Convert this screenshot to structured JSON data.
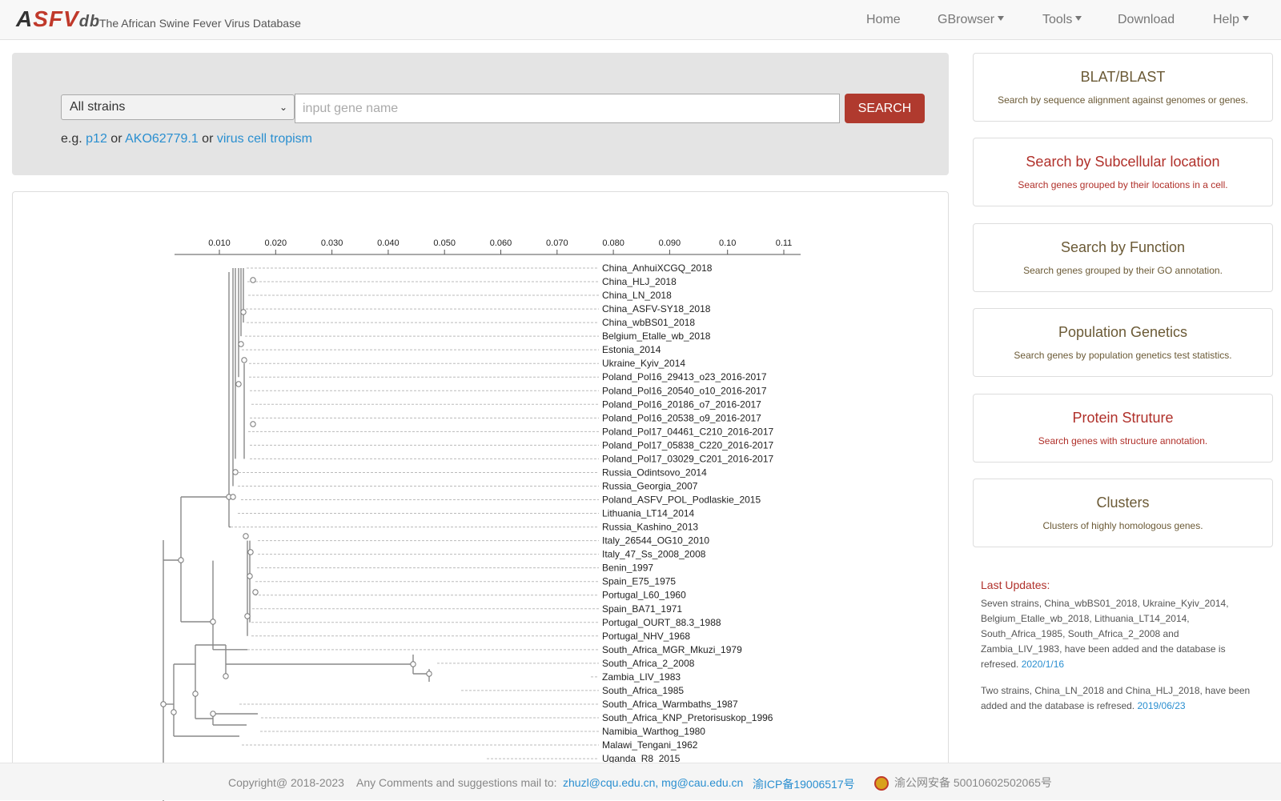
{
  "brand": {
    "logo_a": "A",
    "logo_s": "S",
    "logo_f": "F",
    "logo_v": "V",
    "logo_db": "db",
    "subtitle": "The African Swine Fever Virus Database"
  },
  "nav": {
    "home": "Home",
    "gbrowser": "GBrowser",
    "tools": "Tools",
    "download": "Download",
    "help": "Help"
  },
  "search": {
    "selected_strain": "All strains",
    "placeholder": "input gene name",
    "button": "SEARCH",
    "eg": "e.g.",
    "or": "or",
    "ex1": "p12",
    "ex2": "AKO62779.1",
    "ex3": "virus cell tropism"
  },
  "cards": [
    {
      "title": "BLAT/BLAST",
      "desc": "Search by sequence alignment against genomes or genes.",
      "color": "#6b5a36"
    },
    {
      "title": "Search by Subcellular location",
      "desc": "Search genes grouped by their locations in a cell.",
      "color": "#b0302a"
    },
    {
      "title": "Search by Function",
      "desc": "Search genes grouped by their GO annotation.",
      "color": "#6b5a36"
    },
    {
      "title": "Population Genetics",
      "desc": "Search genes by population genetics test statistics.",
      "color": "#6b5a36"
    },
    {
      "title": "Protein Struture",
      "desc": "Search genes with structure annotation.",
      "color": "#b0302a"
    },
    {
      "title": "Clusters",
      "desc": "Clusters of highly homologous genes.",
      "color": "#6b5a36"
    }
  ],
  "updates": {
    "title": "Last Updates:",
    "items": [
      {
        "text": "Seven strains, China_wbBS01_2018, Ukraine_Kyiv_2014, Belgium_Etalle_wb_2018, Lithuania_LT14_2014, South_Africa_1985, South_Africa_2_2008 and Zambia_LIV_1983, have been added and the database is refresed.",
        "date": "2020/1/16"
      },
      {
        "text": "Two strains, China_LN_2018 and China_HLJ_2018, have been added and the database is refresed.",
        "date": "2019/06/23"
      }
    ]
  },
  "footer": {
    "copyright": "Copyright@ 2018-2023",
    "comments": "Any Comments and suggestions mail to:",
    "emails": "zhuzl@cqu.edu.cn, mg@cau.edu.cn",
    "icp": "渝ICP备19006517号",
    "police": "渝公网安备 50010602502065号"
  },
  "tree": {
    "axis_ticks": [
      "0.010",
      "0.020",
      "0.030",
      "0.040",
      "0.050",
      "0.060",
      "0.070",
      "0.080",
      "0.090",
      "0.10",
      "0.11"
    ],
    "leaves": [
      "China_AnhuiXCGQ_2018",
      "China_HLJ_2018",
      "China_LN_2018",
      "China_ASFV-SY18_2018",
      "China_wbBS01_2018",
      "Belgium_Etalle_wb_2018",
      "Estonia_2014",
      "Ukraine_Kyiv_2014",
      "Poland_Pol16_29413_o23_2016-2017",
      "Poland_Pol16_20540_o10_2016-2017",
      "Poland_Pol16_20186_o7_2016-2017",
      "Poland_Pol16_20538_o9_2016-2017",
      "Poland_Pol17_04461_C210_2016-2017",
      "Poland_Pol17_05838_C220_2016-2017",
      "Poland_Pol17_03029_C201_2016-2017",
      "Russia_Odintsovo_2014",
      "Russia_Georgia_2007",
      "Poland_ASFV_POL_Podlaskie_2015",
      "Lithuania_LT14_2014",
      "Russia_Kashino_2013",
      "Italy_26544_OG10_2010",
      "Italy_47_Ss_2008_2008",
      "Benin_1997",
      "Spain_E75_1975",
      "Portugal_L60_1960",
      "Spain_BA71_1971",
      "Portugal_OURT_88.3_1988",
      "Portugal_NHV_1968",
      "South_Africa_MGR_Mkuzi_1979",
      "South_Africa_2_2008",
      "Zambia_LIV_1983",
      "South_Africa_1985",
      "South_Africa_Warmbaths_1987",
      "South_Africa_KNP_Pretorisuskop_1996",
      "Namibia_Warthog_1980",
      "Malawi_Tengani_1962",
      "Uganda_R8_2015"
    ]
  }
}
